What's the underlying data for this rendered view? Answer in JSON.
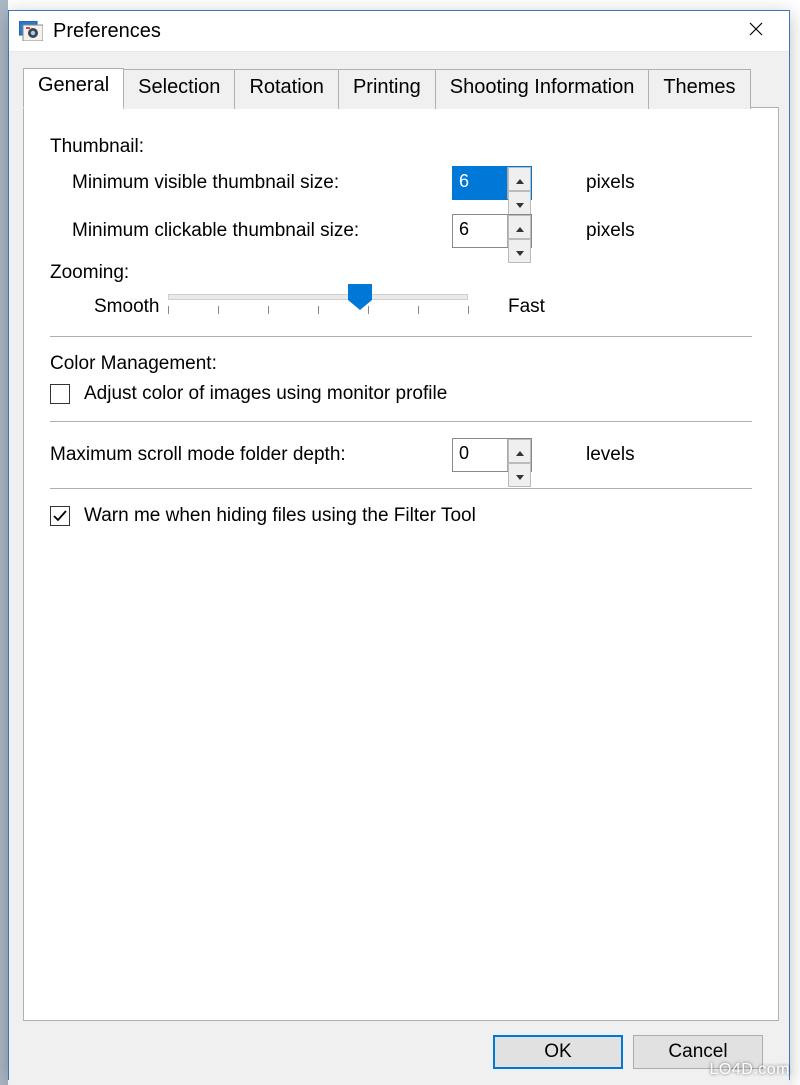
{
  "window": {
    "title": "Preferences"
  },
  "tabs": {
    "t0": "General",
    "t1": "Selection",
    "t2": "Rotation",
    "t3": "Printing",
    "t4": "Shooting Information",
    "t5": "Themes"
  },
  "thumbnail": {
    "heading": "Thumbnail:",
    "min_visible_label": "Minimum visible thumbnail size:",
    "min_visible_value": "6",
    "min_clickable_label": "Minimum clickable thumbnail size:",
    "min_clickable_value": "6",
    "unit": "pixels"
  },
  "zooming": {
    "heading": "Zooming:",
    "left_label": "Smooth",
    "right_label": "Fast"
  },
  "color_mgmt": {
    "heading": "Color Management:",
    "checkbox_label": "Adjust color of images using monitor profile",
    "checked": false
  },
  "scroll": {
    "label": "Maximum scroll mode folder depth:",
    "value": "0",
    "unit": "levels"
  },
  "warn": {
    "label": "Warn me when hiding files using the Filter Tool",
    "checked": true
  },
  "buttons": {
    "ok": "OK",
    "cancel": "Cancel"
  },
  "watermark": "LO4D.com"
}
